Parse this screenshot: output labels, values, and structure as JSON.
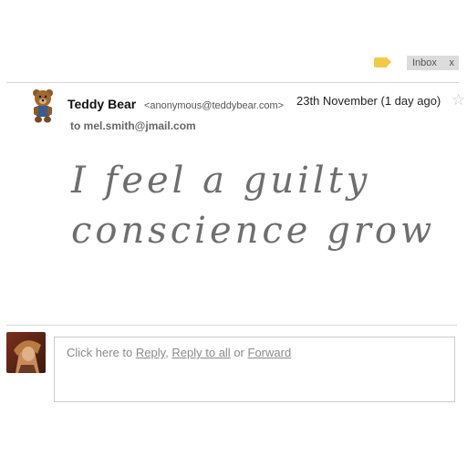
{
  "toolbar": {
    "label_icon": "label-tag-icon",
    "label_color": "#f3c94a",
    "inbox_chip": {
      "label": "Inbox",
      "remove": "x"
    }
  },
  "message": {
    "sender_name": "Teddy Bear",
    "sender_email": "<anonymous@teddybear.com>",
    "date": "23th November (1 day ago)",
    "star_icon": "star-icon",
    "to_line": "to mel.smith@jmail.com",
    "body_lines": [
      "I feel a guilty",
      "conscience grow"
    ]
  },
  "reply": {
    "prefix": "Click here to ",
    "reply_label": "Reply",
    "sep1": ", ",
    "reply_all_label": "Reply to all",
    "sep2": " or ",
    "forward_label": "Forward"
  }
}
